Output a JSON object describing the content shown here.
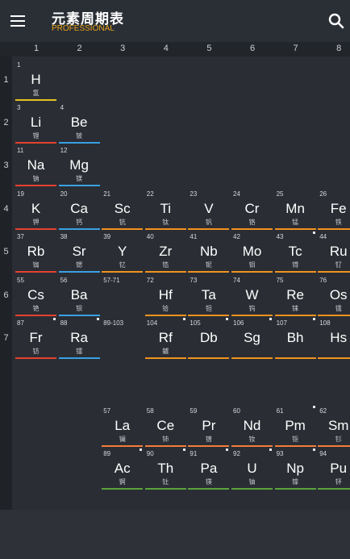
{
  "app": {
    "title": "元素周期表",
    "subtitle": "PROFESSIONAL"
  },
  "columns": [
    "1",
    "2",
    "3",
    "4",
    "5",
    "6",
    "7",
    "8"
  ],
  "rows": [
    "1",
    "2",
    "3",
    "4",
    "5",
    "6",
    "7"
  ],
  "colors": {
    "hydrogen": "#e8c21f",
    "alkali": "#e6402e",
    "alkaline": "#3aa0e2",
    "transition": "#f2921e",
    "lanthanide": "#f47c3c",
    "actinide": "#5aa33c",
    "none": "transparent"
  },
  "elements": [
    {
      "n": "1",
      "s": "H",
      "c": "氢",
      "col": 1,
      "row": 1,
      "cat": "hydrogen"
    },
    {
      "n": "3",
      "s": "Li",
      "c": "锂",
      "col": 1,
      "row": 2,
      "cat": "alkali"
    },
    {
      "n": "4",
      "s": "Be",
      "c": "铍",
      "col": 2,
      "row": 2,
      "cat": "alkaline"
    },
    {
      "n": "11",
      "s": "Na",
      "c": "钠",
      "col": 1,
      "row": 3,
      "cat": "alkali"
    },
    {
      "n": "12",
      "s": "Mg",
      "c": "镁",
      "col": 2,
      "row": 3,
      "cat": "alkaline"
    },
    {
      "n": "19",
      "s": "K",
      "c": "钾",
      "col": 1,
      "row": 4,
      "cat": "alkali"
    },
    {
      "n": "20",
      "s": "Ca",
      "c": "钙",
      "col": 2,
      "row": 4,
      "cat": "alkaline"
    },
    {
      "n": "21",
      "s": "Sc",
      "c": "钪",
      "col": 3,
      "row": 4,
      "cat": "transition"
    },
    {
      "n": "22",
      "s": "Ti",
      "c": "钛",
      "col": 4,
      "row": 4,
      "cat": "transition"
    },
    {
      "n": "23",
      "s": "V",
      "c": "钒",
      "col": 5,
      "row": 4,
      "cat": "transition"
    },
    {
      "n": "24",
      "s": "Cr",
      "c": "铬",
      "col": 6,
      "row": 4,
      "cat": "transition"
    },
    {
      "n": "25",
      "s": "Mn",
      "c": "锰",
      "col": 7,
      "row": 4,
      "cat": "transition"
    },
    {
      "n": "26",
      "s": "Fe",
      "c": "铁",
      "col": 8,
      "row": 4,
      "cat": "transition"
    },
    {
      "n": "37",
      "s": "Rb",
      "c": "铷",
      "col": 1,
      "row": 5,
      "cat": "alkali"
    },
    {
      "n": "38",
      "s": "Sr",
      "c": "锶",
      "col": 2,
      "row": 5,
      "cat": "alkaline"
    },
    {
      "n": "39",
      "s": "Y",
      "c": "钇",
      "col": 3,
      "row": 5,
      "cat": "transition"
    },
    {
      "n": "40",
      "s": "Zr",
      "c": "锆",
      "col": 4,
      "row": 5,
      "cat": "transition"
    },
    {
      "n": "41",
      "s": "Nb",
      "c": "铌",
      "col": 5,
      "row": 5,
      "cat": "transition"
    },
    {
      "n": "42",
      "s": "Mo",
      "c": "钼",
      "col": 6,
      "row": 5,
      "cat": "transition"
    },
    {
      "n": "43",
      "s": "Tc",
      "c": "锝",
      "col": 7,
      "row": 5,
      "cat": "transition",
      "dot": true
    },
    {
      "n": "44",
      "s": "Ru",
      "c": "钌",
      "col": 8,
      "row": 5,
      "cat": "transition"
    },
    {
      "n": "55",
      "s": "Cs",
      "c": "铯",
      "col": 1,
      "row": 6,
      "cat": "alkali"
    },
    {
      "n": "56",
      "s": "Ba",
      "c": "钡",
      "col": 2,
      "row": 6,
      "cat": "alkaline"
    },
    {
      "n": "57-71",
      "s": "",
      "c": "",
      "col": 3,
      "row": 6,
      "cat": "none"
    },
    {
      "n": "72",
      "s": "Hf",
      "c": "铪",
      "col": 4,
      "row": 6,
      "cat": "transition"
    },
    {
      "n": "73",
      "s": "Ta",
      "c": "钽",
      "col": 5,
      "row": 6,
      "cat": "transition"
    },
    {
      "n": "74",
      "s": "W",
      "c": "钨",
      "col": 6,
      "row": 6,
      "cat": "transition"
    },
    {
      "n": "75",
      "s": "Re",
      "c": "铼",
      "col": 7,
      "row": 6,
      "cat": "transition"
    },
    {
      "n": "76",
      "s": "Os",
      "c": "锇",
      "col": 8,
      "row": 6,
      "cat": "transition"
    },
    {
      "n": "87",
      "s": "Fr",
      "c": "钫",
      "col": 1,
      "row": 7,
      "cat": "alkali",
      "dot": true
    },
    {
      "n": "88",
      "s": "Ra",
      "c": "镭",
      "col": 2,
      "row": 7,
      "cat": "alkaline",
      "dot": true
    },
    {
      "n": "89-103",
      "s": "",
      "c": "",
      "col": 3,
      "row": 7,
      "cat": "none"
    },
    {
      "n": "104",
      "s": "Rf",
      "c": "鑪",
      "col": 4,
      "row": 7,
      "cat": "transition",
      "dot": true
    },
    {
      "n": "105",
      "s": "Db",
      "c": "",
      "col": 5,
      "row": 7,
      "cat": "transition",
      "dot": true
    },
    {
      "n": "106",
      "s": "Sg",
      "c": "",
      "col": 6,
      "row": 7,
      "cat": "transition",
      "dot": true
    },
    {
      "n": "107",
      "s": "Bh",
      "c": "",
      "col": 7,
      "row": 7,
      "cat": "transition",
      "dot": true
    },
    {
      "n": "108",
      "s": "Hs",
      "c": "",
      "col": 8,
      "row": 7,
      "cat": "transition",
      "dot": true
    },
    {
      "n": "57",
      "s": "La",
      "c": "镧",
      "col": 3,
      "row": 9,
      "cat": "lanthanide"
    },
    {
      "n": "58",
      "s": "Ce",
      "c": "铈",
      "col": 4,
      "row": 9,
      "cat": "lanthanide"
    },
    {
      "n": "59",
      "s": "Pr",
      "c": "镨",
      "col": 5,
      "row": 9,
      "cat": "lanthanide"
    },
    {
      "n": "60",
      "s": "Nd",
      "c": "钕",
      "col": 6,
      "row": 9,
      "cat": "lanthanide"
    },
    {
      "n": "61",
      "s": "Pm",
      "c": "钷",
      "col": 7,
      "row": 9,
      "cat": "lanthanide",
      "dot": true
    },
    {
      "n": "62",
      "s": "Sm",
      "c": "钐",
      "col": 8,
      "row": 9,
      "cat": "lanthanide"
    },
    {
      "n": "89",
      "s": "Ac",
      "c": "锕",
      "col": 3,
      "row": 10,
      "cat": "actinide",
      "dot": true
    },
    {
      "n": "90",
      "s": "Th",
      "c": "钍",
      "col": 4,
      "row": 10,
      "cat": "actinide",
      "dot": true
    },
    {
      "n": "91",
      "s": "Pa",
      "c": "镤",
      "col": 5,
      "row": 10,
      "cat": "actinide",
      "dot": true
    },
    {
      "n": "92",
      "s": "U",
      "c": "铀",
      "col": 6,
      "row": 10,
      "cat": "actinide",
      "dot": true
    },
    {
      "n": "93",
      "s": "Np",
      "c": "镎",
      "col": 7,
      "row": 10,
      "cat": "actinide",
      "dot": true
    },
    {
      "n": "94",
      "s": "Pu",
      "c": "钚",
      "col": 8,
      "row": 10,
      "cat": "actinide",
      "dot": true
    }
  ]
}
